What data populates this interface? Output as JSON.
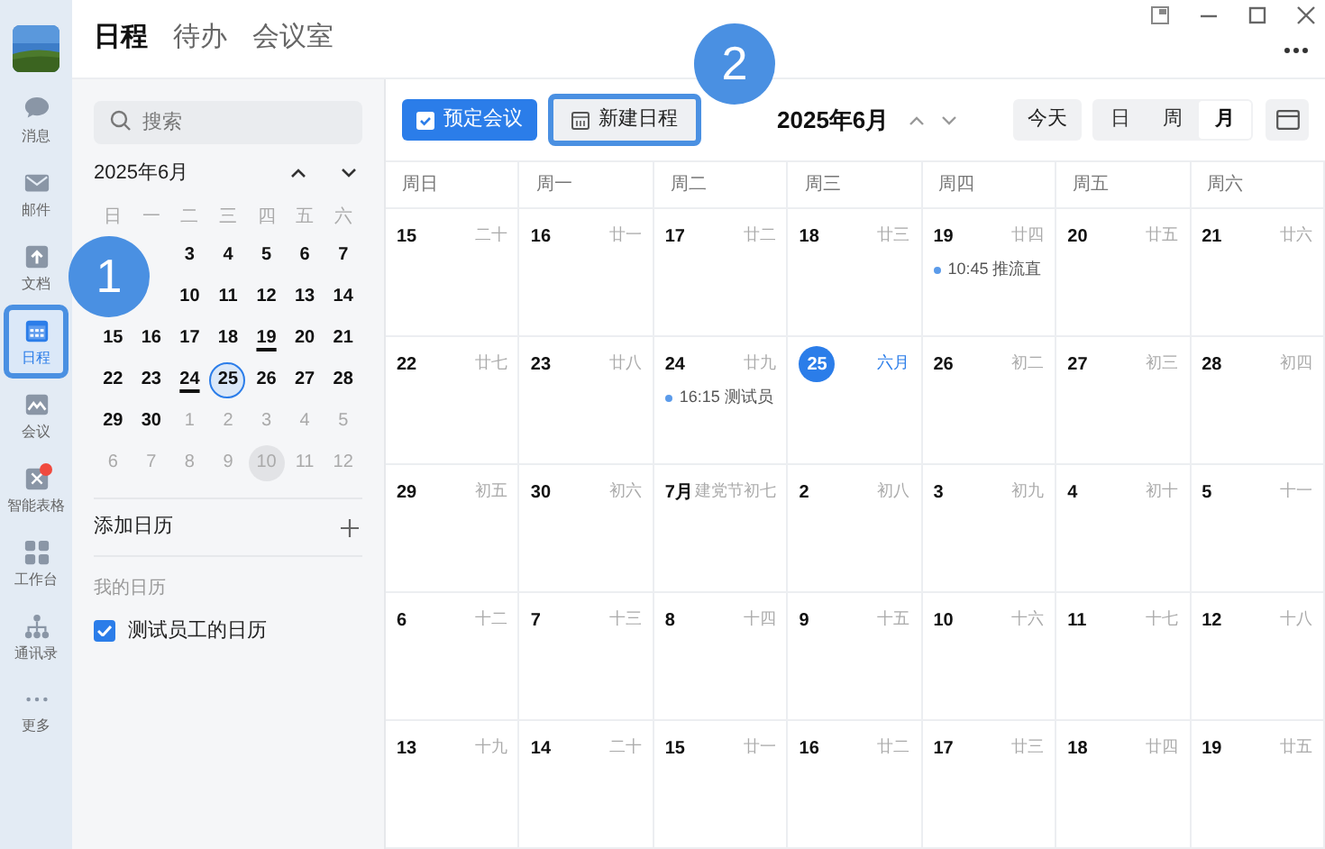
{
  "rail": {
    "items": [
      {
        "kind": "chat",
        "label": "消息",
        "selected": false,
        "badge": false
      },
      {
        "kind": "mail",
        "label": "邮件",
        "selected": false,
        "badge": false
      },
      {
        "kind": "doc",
        "label": "文档",
        "selected": false,
        "badge": false
      },
      {
        "kind": "calendar",
        "label": "日程",
        "selected": true,
        "badge": false
      },
      {
        "kind": "meeting",
        "label": "会议",
        "selected": false,
        "badge": false
      },
      {
        "kind": "sheet",
        "label": "智能表格",
        "selected": false,
        "badge": true
      },
      {
        "kind": "apps",
        "label": "工作台",
        "selected": false,
        "badge": false
      },
      {
        "kind": "contacts",
        "label": "通讯录",
        "selected": false,
        "badge": false
      },
      {
        "kind": "more",
        "label": "更多",
        "selected": false,
        "badge": false
      }
    ]
  },
  "tabs": [
    {
      "label": "日程",
      "selected": true
    },
    {
      "label": "待办",
      "selected": false
    },
    {
      "label": "会议室",
      "selected": false
    }
  ],
  "sidebar": {
    "search": {
      "placeholder": "搜索"
    },
    "mini_calendar": {
      "title": "2025年6月",
      "weekdays": [
        "日",
        "一",
        "二",
        "三",
        "四",
        "五",
        "六"
      ],
      "weeks": [
        [
          {
            "day": "3"
          },
          {
            "day": "4"
          },
          {
            "day": "5"
          },
          {
            "day": "6"
          },
          {
            "day": "7"
          }
        ],
        [
          {
            "day": "10"
          },
          {
            "day": "11"
          },
          {
            "day": "12"
          },
          {
            "day": "13"
          },
          {
            "day": "14"
          }
        ],
        [
          {
            "day": "15"
          },
          {
            "day": "16"
          },
          {
            "day": "17"
          },
          {
            "day": "18"
          },
          {
            "day": "19",
            "underlined": true
          },
          {
            "day": "20"
          },
          {
            "day": "21"
          }
        ],
        [
          {
            "day": "22"
          },
          {
            "day": "23"
          },
          {
            "day": "24",
            "underlined": true
          },
          {
            "day": "25",
            "today": true
          },
          {
            "day": "26"
          },
          {
            "day": "27"
          },
          {
            "day": "28"
          }
        ],
        [
          {
            "day": "29"
          },
          {
            "day": "30"
          },
          {
            "day": "1",
            "muted": true
          },
          {
            "day": "2",
            "muted": true
          },
          {
            "day": "3",
            "muted": true
          },
          {
            "day": "4",
            "muted": true
          },
          {
            "day": "5",
            "muted": true
          }
        ],
        [
          {
            "day": "6",
            "muted": true
          },
          {
            "day": "7",
            "muted": true
          },
          {
            "day": "8",
            "muted": true
          },
          {
            "day": "9",
            "muted": true
          },
          {
            "day": "10",
            "muted": true,
            "hovered": true
          },
          {
            "day": "11",
            "muted": true
          },
          {
            "day": "12",
            "muted": true
          }
        ]
      ]
    },
    "add_calendar": "添加日历",
    "my_calendars": {
      "heading": "我的日历",
      "items": [
        {
          "label": "测试员工的日历",
          "checked": true
        }
      ]
    }
  },
  "toolbar": {
    "book_meeting": "预定会议",
    "new_event": "新建日程",
    "title": "2025年6月",
    "today": "今天",
    "views": [
      {
        "label": "日",
        "selected": false
      },
      {
        "label": "周",
        "selected": false
      },
      {
        "label": "月",
        "selected": true
      }
    ]
  },
  "month": {
    "weekdays": [
      "周日",
      "周一",
      "周二",
      "周三",
      "周四",
      "周五",
      "周六"
    ],
    "weeks": [
      [
        {
          "day": "15",
          "lunar": "二十"
        },
        {
          "day": "16",
          "lunar": "廿一"
        },
        {
          "day": "17",
          "lunar": "廿二"
        },
        {
          "day": "18",
          "lunar": "廿三"
        },
        {
          "day": "19",
          "lunar": "廿四",
          "events": [
            {
              "time": "10:45",
              "title": "推流直",
              "color": "#5b9bea"
            }
          ]
        },
        {
          "day": "20",
          "lunar": "廿五"
        },
        {
          "day": "21",
          "lunar": "廿六"
        }
      ],
      [
        {
          "day": "22",
          "lunar": "廿七"
        },
        {
          "day": "23",
          "lunar": "廿八"
        },
        {
          "day": "24",
          "lunar": "廿九",
          "events": [
            {
              "time": "16:15",
              "title": "测试员",
              "color": "#5b9bea"
            }
          ]
        },
        {
          "day": "25",
          "lunar": "六月",
          "today": true
        },
        {
          "day": "26",
          "lunar": "初二"
        },
        {
          "day": "27",
          "lunar": "初三"
        },
        {
          "day": "28",
          "lunar": "初四"
        }
      ],
      [
        {
          "day": "29",
          "lunar": "初五"
        },
        {
          "day": "30",
          "lunar": "初六"
        },
        {
          "day": "7月",
          "lunar": "建党节初七"
        },
        {
          "day": "2",
          "lunar": "初八"
        },
        {
          "day": "3",
          "lunar": "初九"
        },
        {
          "day": "4",
          "lunar": "初十"
        },
        {
          "day": "5",
          "lunar": "十一"
        }
      ],
      [
        {
          "day": "6",
          "lunar": "十二"
        },
        {
          "day": "7",
          "lunar": "十三"
        },
        {
          "day": "8",
          "lunar": "十四"
        },
        {
          "day": "9",
          "lunar": "十五"
        },
        {
          "day": "10",
          "lunar": "十六"
        },
        {
          "day": "11",
          "lunar": "十七"
        },
        {
          "day": "12",
          "lunar": "十八"
        }
      ],
      [
        {
          "day": "13",
          "lunar": "十九"
        },
        {
          "day": "14",
          "lunar": "二十"
        },
        {
          "day": "15",
          "lunar": "廿一"
        },
        {
          "day": "16",
          "lunar": "廿二"
        },
        {
          "day": "17",
          "lunar": "廿三"
        },
        {
          "day": "18",
          "lunar": "廿四"
        },
        {
          "day": "19",
          "lunar": "廿五"
        }
      ]
    ]
  },
  "callouts": [
    {
      "label": "1"
    },
    {
      "label": "2"
    }
  ]
}
